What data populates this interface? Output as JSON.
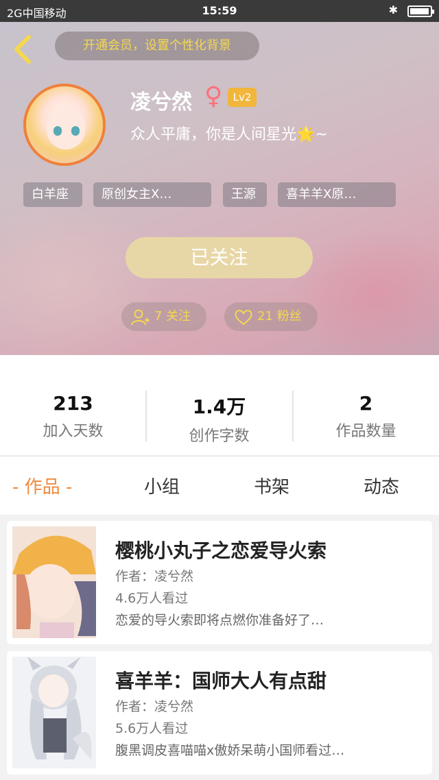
{
  "status_bar": {
    "carrier": "2G中国移动",
    "time": "15:59"
  },
  "header": {
    "vip_banner": "开通会员，设置个性化背景",
    "username": "凌兮然",
    "gender_symbol": "♀",
    "level": "Lv2",
    "signature": "众人平庸，你是人间星光🌟~",
    "tags": [
      "白羊座",
      "原创女主X…",
      "王源",
      "喜羊羊X原…"
    ],
    "follow_button": "已关注",
    "following_count": "7 关注",
    "fans_count": "21 粉丝"
  },
  "stats": [
    {
      "value": "213",
      "label": "加入天数"
    },
    {
      "value": "1.4万",
      "label": "创作字数"
    },
    {
      "value": "2",
      "label": "作品数量"
    }
  ],
  "tabs": [
    "- 作品 -",
    "小组",
    "书架",
    "动态"
  ],
  "works": [
    {
      "title": "樱桃小丸子之恋爱导火索",
      "author": "作者：凌兮然",
      "views": "4.6万人看过",
      "description": "恋爱的导火索即将点燃你准备好了…"
    },
    {
      "title": "喜羊羊：国师大人有点甜",
      "author": "作者：凌兮然",
      "views": "5.6万人看过",
      "description": "腹黑调皮喜喵喵x傲娇呆萌小国师看过…"
    }
  ]
}
